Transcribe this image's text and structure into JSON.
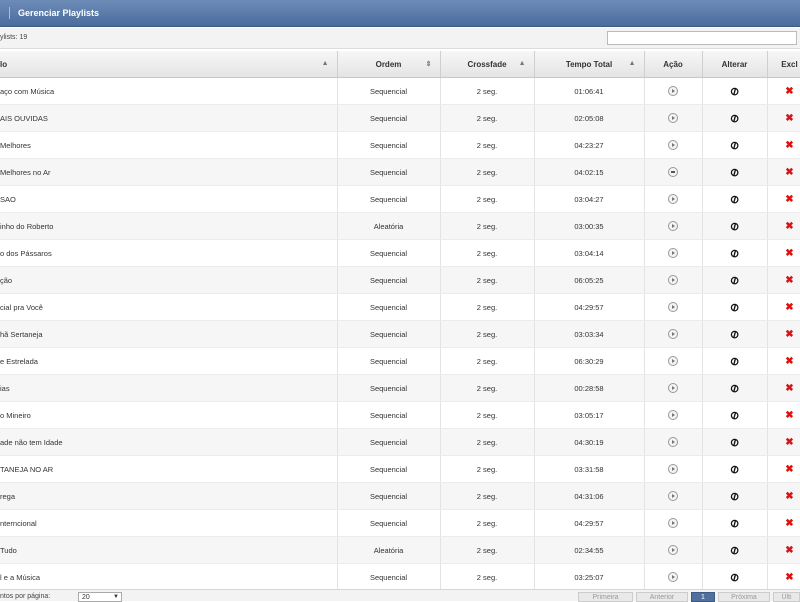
{
  "title": "Gerenciar Playlists",
  "info": {
    "count_label": "ylists:",
    "count_value": "19"
  },
  "search": {
    "value": "",
    "placeholder": ""
  },
  "columns": {
    "name": "lo",
    "ordem": "Ordem",
    "crossfade": "Crossfade",
    "tempo": "Tempo Total",
    "acao": "Ação",
    "alterar": "Alterar",
    "excluir": "Excl"
  },
  "rows": [
    {
      "name": "aço com Música",
      "ordem": "Sequencial",
      "crossfade": "2 seg.",
      "tempo": "01:06:41"
    },
    {
      "name": "AIS OUVIDAS",
      "ordem": "Sequencial",
      "crossfade": "2 seg.",
      "tempo": "02:05:08"
    },
    {
      "name": "Melhores",
      "ordem": "Sequencial",
      "crossfade": "2 seg.",
      "tempo": "04:23:27"
    },
    {
      "name": "Melhores no Ar",
      "ordem": "Sequencial",
      "crossfade": "2 seg.",
      "tempo": "04:02:15"
    },
    {
      "name": "SAO",
      "ordem": "Sequencial",
      "crossfade": "2 seg.",
      "tempo": "03:04:27"
    },
    {
      "name": "inho do Roberto",
      "ordem": "Aleatória",
      "crossfade": "2 seg.",
      "tempo": "03:00:35"
    },
    {
      "name": "o dos Pássaros",
      "ordem": "Sequencial",
      "crossfade": "2 seg.",
      "tempo": "03:04:14"
    },
    {
      "name": "ção",
      "ordem": "Sequencial",
      "crossfade": "2 seg.",
      "tempo": "06:05:25"
    },
    {
      "name": "cial pra Você",
      "ordem": "Sequencial",
      "crossfade": "2 seg.",
      "tempo": "04:29:57"
    },
    {
      "name": "hã Sertaneja",
      "ordem": "Sequencial",
      "crossfade": "2 seg.",
      "tempo": "03:03:34"
    },
    {
      "name": "e Estrelada",
      "ordem": "Sequencial",
      "crossfade": "2 seg.",
      "tempo": "06:30:29"
    },
    {
      "name": "ias",
      "ordem": "Sequencial",
      "crossfade": "2 seg.",
      "tempo": "00:28:58"
    },
    {
      "name": "o Mineiro",
      "ordem": "Sequencial",
      "crossfade": "2 seg.",
      "tempo": "03:05:17"
    },
    {
      "name": "ade não tem Idade",
      "ordem": "Sequencial",
      "crossfade": "2 seg.",
      "tempo": "04:30:19"
    },
    {
      "name": "TANEJA NO AR",
      "ordem": "Sequencial",
      "crossfade": "2 seg.",
      "tempo": "03:31:58"
    },
    {
      "name": "rega",
      "ordem": "Sequencial",
      "crossfade": "2 seg.",
      "tempo": "04:31:06"
    },
    {
      "name": "nterncional",
      "ordem": "Sequencial",
      "crossfade": "2 seg.",
      "tempo": "04:29:57"
    },
    {
      "name": "Tudo",
      "ordem": "Aleatória",
      "crossfade": "2 seg.",
      "tempo": "02:34:55"
    },
    {
      "name": "l e a Música",
      "ordem": "Sequencial",
      "crossfade": "2 seg.",
      "tempo": "03:25:07"
    }
  ],
  "footer": {
    "per_page_label": "ntos por página:",
    "per_page_value": "20",
    "pager": {
      "first": "Primeira",
      "prev": "Anterior",
      "current": "1",
      "next": "Próxima",
      "last": "Últi"
    }
  },
  "colors": {
    "titlebar": "#5575a5",
    "delete": "#dd1111",
    "pager_current": "#4f6f9f"
  },
  "icons": {
    "action": "play-icon",
    "edit": "link-icon",
    "delete": "delete-x-icon"
  }
}
